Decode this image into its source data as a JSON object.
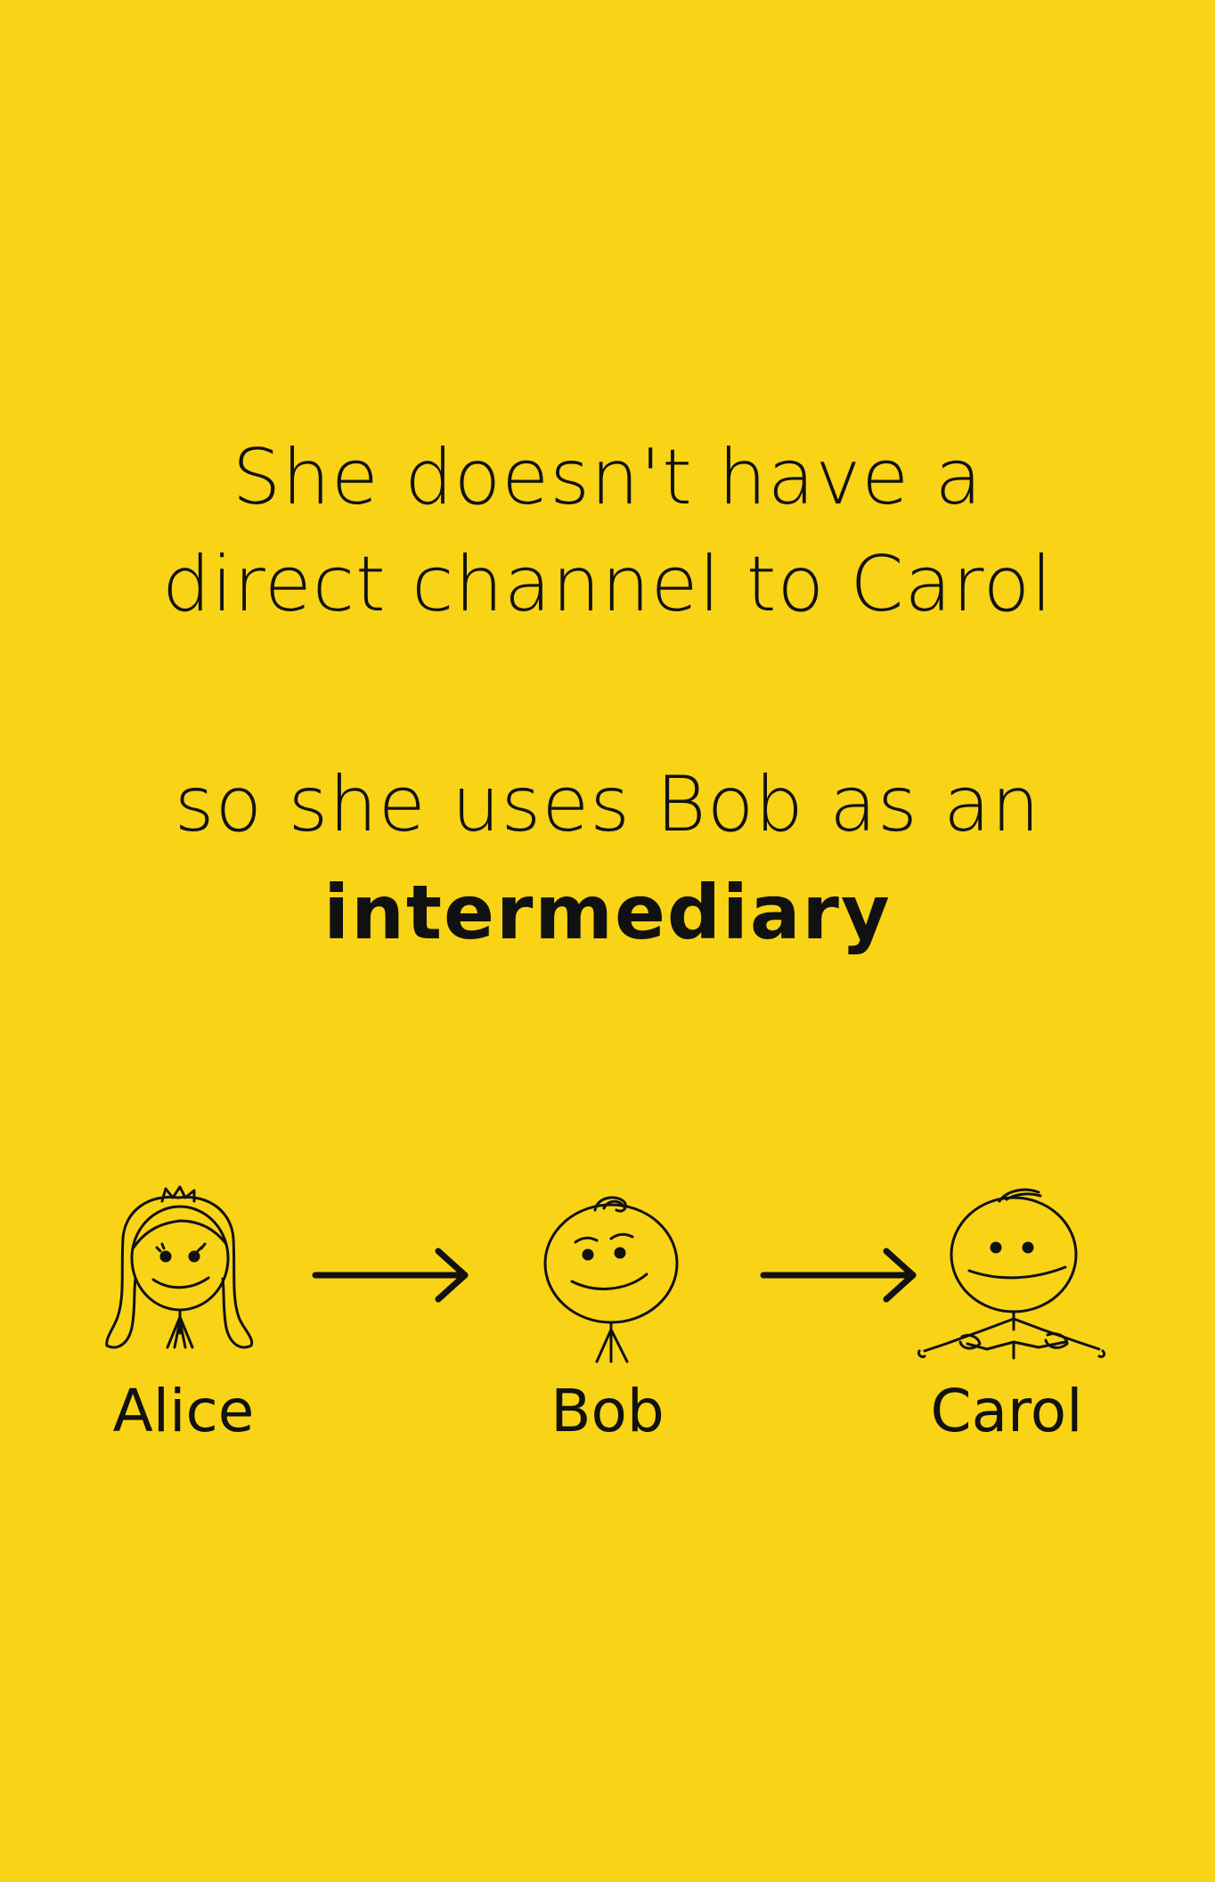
{
  "colors": {
    "background": "#F9D316",
    "ink": "#111111"
  },
  "text": {
    "line1": "She doesn't have a",
    "line2": "direct channel to Carol",
    "line3": "so she uses Bob as an",
    "line4": "intermediary"
  },
  "people": {
    "alice": "Alice",
    "bob": "Bob",
    "carol": "Carol"
  },
  "icons": {
    "alice": "stick-figure-girl-icon",
    "bob": "stick-figure-boy-icon",
    "carol": "stick-figure-person-icon",
    "arrow1": "arrow-right-icon",
    "arrow2": "arrow-right-icon"
  }
}
